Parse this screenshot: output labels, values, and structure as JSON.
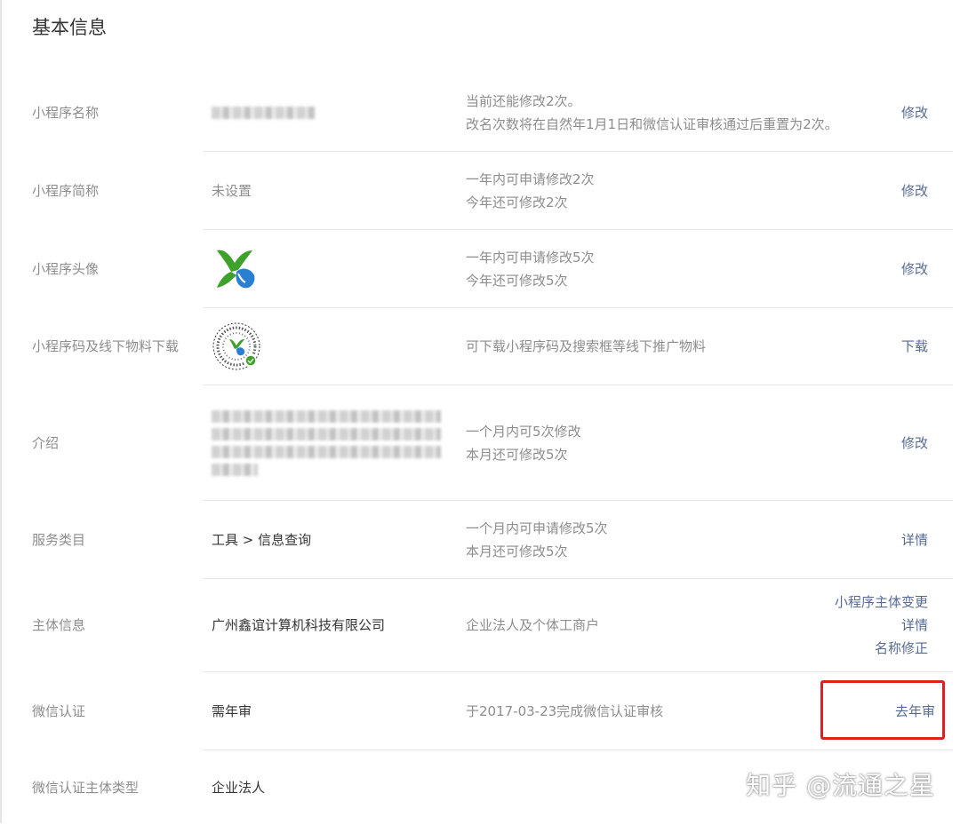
{
  "page_title": "基本信息",
  "rows": [
    {
      "label": "小程序名称",
      "desc_lines": [
        "当前还能修改2次。",
        "改名次数将在自然年1月1日和微信认证审核通过后重置为2次。"
      ],
      "actions": [
        "修改"
      ]
    },
    {
      "label": "小程序简称",
      "value": "未设置",
      "desc_lines": [
        "一年内可申请修改2次",
        "今年还可修改2次"
      ],
      "actions": [
        "修改"
      ]
    },
    {
      "label": "小程序头像",
      "desc_lines": [
        "一年内可申请修改5次",
        "今年还可修改5次"
      ],
      "actions": [
        "修改"
      ]
    },
    {
      "label": "小程序码及线下物料下载",
      "desc_lines": [
        "可下载小程序码及搜索框等线下推广物料"
      ],
      "actions": [
        "下载"
      ]
    },
    {
      "label": "介绍",
      "desc_lines": [
        "一个月内可5次修改",
        "本月还可修改5次"
      ],
      "actions": [
        "修改"
      ]
    },
    {
      "label": "服务类目",
      "value": "工具 > 信息查询",
      "desc_lines": [
        "一个月内可申请修改5次",
        "本月还可修改5次"
      ],
      "actions": [
        "详情"
      ]
    },
    {
      "label": "主体信息",
      "value": "广州鑫谊计算机科技有限公司",
      "desc_lines": [
        "企业法人及个体工商户"
      ],
      "actions": [
        "小程序主体变更",
        "详情",
        "名称修正"
      ]
    },
    {
      "label": "微信认证",
      "value": "需年审",
      "desc_lines": [
        "于2017-03-23完成微信认证审核"
      ],
      "actions": [
        "去年审"
      ]
    },
    {
      "label": "微信认证主体类型",
      "value": "企业法人"
    }
  ],
  "watermark": "知乎 @流通之星",
  "colors": {
    "link": "#576b95",
    "label": "#8d8d8d",
    "text": "#353535",
    "divider": "#e7e7eb",
    "highlight": "#e02020"
  }
}
